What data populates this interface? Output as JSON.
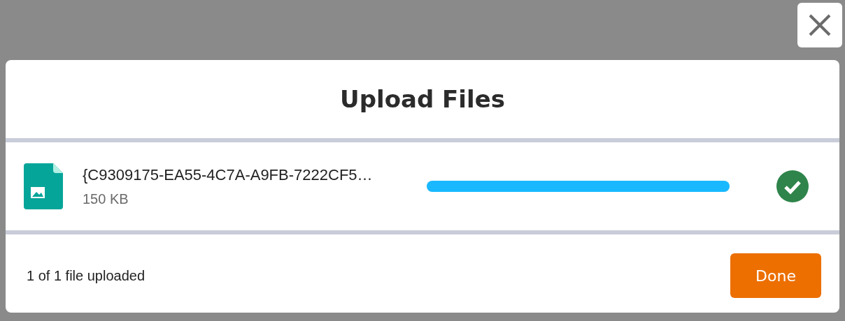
{
  "dialog": {
    "title": "Upload Files"
  },
  "files": [
    {
      "name": "{C9309175-EA55-4C7A-A9FB-7222CF5…",
      "size": "150 KB",
      "level": 1,
      "complete": true
    }
  ],
  "footer": {
    "status": "1 of 1 file uploaded",
    "button": "Done"
  }
}
